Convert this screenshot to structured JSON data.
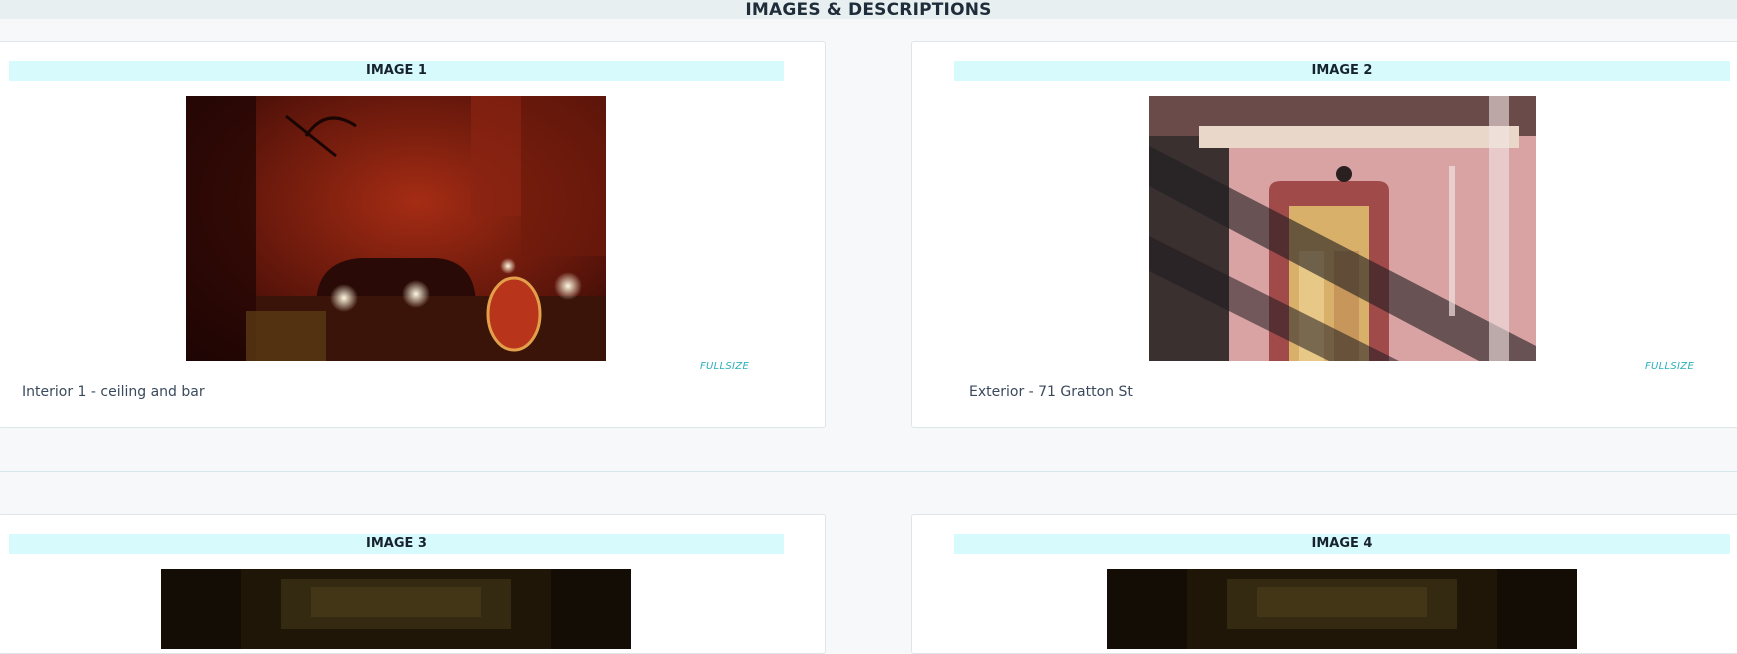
{
  "page": {
    "title": "IMAGES & DESCRIPTIONS"
  },
  "cards": [
    {
      "header": "IMAGE 1",
      "fullsize_label": "FULLSIZE",
      "description": "Interior 1 - ceiling and bar",
      "photo_icon": "bar-interior-photo"
    },
    {
      "header": "IMAGE 2",
      "fullsize_label": "FULLSIZE",
      "description": "Exterior - 71 Gratton St",
      "photo_icon": "building-exterior-photo"
    },
    {
      "header": "IMAGE 3",
      "photo_icon": "dark-interior-photo"
    },
    {
      "header": "IMAGE 4",
      "photo_icon": "dark-interior-photo"
    }
  ],
  "colors": {
    "header_bg": "#d7fafd",
    "link": "#2ab0b8",
    "page_bg": "#f6f8f9"
  }
}
